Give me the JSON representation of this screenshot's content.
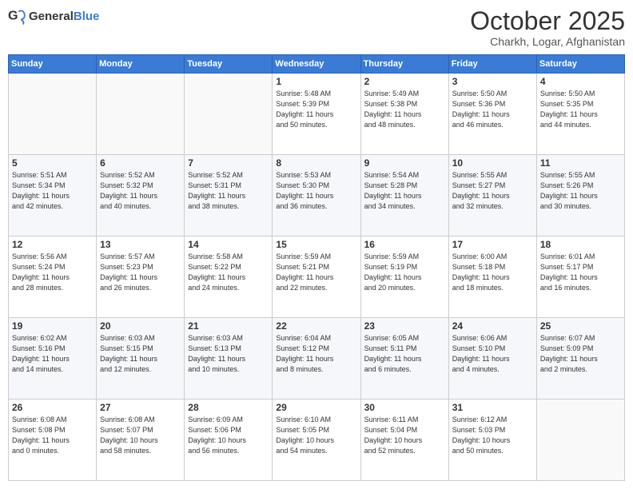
{
  "header": {
    "logo_general": "General",
    "logo_blue": "Blue",
    "month": "October 2025",
    "location": "Charkh, Logar, Afghanistan"
  },
  "weekdays": [
    "Sunday",
    "Monday",
    "Tuesday",
    "Wednesday",
    "Thursday",
    "Friday",
    "Saturday"
  ],
  "weeks": [
    [
      {
        "day": "",
        "info": ""
      },
      {
        "day": "",
        "info": ""
      },
      {
        "day": "",
        "info": ""
      },
      {
        "day": "1",
        "info": "Sunrise: 5:48 AM\nSunset: 5:39 PM\nDaylight: 11 hours\nand 50 minutes."
      },
      {
        "day": "2",
        "info": "Sunrise: 5:49 AM\nSunset: 5:38 PM\nDaylight: 11 hours\nand 48 minutes."
      },
      {
        "day": "3",
        "info": "Sunrise: 5:50 AM\nSunset: 5:36 PM\nDaylight: 11 hours\nand 46 minutes."
      },
      {
        "day": "4",
        "info": "Sunrise: 5:50 AM\nSunset: 5:35 PM\nDaylight: 11 hours\nand 44 minutes."
      }
    ],
    [
      {
        "day": "5",
        "info": "Sunrise: 5:51 AM\nSunset: 5:34 PM\nDaylight: 11 hours\nand 42 minutes."
      },
      {
        "day": "6",
        "info": "Sunrise: 5:52 AM\nSunset: 5:32 PM\nDaylight: 11 hours\nand 40 minutes."
      },
      {
        "day": "7",
        "info": "Sunrise: 5:52 AM\nSunset: 5:31 PM\nDaylight: 11 hours\nand 38 minutes."
      },
      {
        "day": "8",
        "info": "Sunrise: 5:53 AM\nSunset: 5:30 PM\nDaylight: 11 hours\nand 36 minutes."
      },
      {
        "day": "9",
        "info": "Sunrise: 5:54 AM\nSunset: 5:28 PM\nDaylight: 11 hours\nand 34 minutes."
      },
      {
        "day": "10",
        "info": "Sunrise: 5:55 AM\nSunset: 5:27 PM\nDaylight: 11 hours\nand 32 minutes."
      },
      {
        "day": "11",
        "info": "Sunrise: 5:55 AM\nSunset: 5:26 PM\nDaylight: 11 hours\nand 30 minutes."
      }
    ],
    [
      {
        "day": "12",
        "info": "Sunrise: 5:56 AM\nSunset: 5:24 PM\nDaylight: 11 hours\nand 28 minutes."
      },
      {
        "day": "13",
        "info": "Sunrise: 5:57 AM\nSunset: 5:23 PM\nDaylight: 11 hours\nand 26 minutes."
      },
      {
        "day": "14",
        "info": "Sunrise: 5:58 AM\nSunset: 5:22 PM\nDaylight: 11 hours\nand 24 minutes."
      },
      {
        "day": "15",
        "info": "Sunrise: 5:59 AM\nSunset: 5:21 PM\nDaylight: 11 hours\nand 22 minutes."
      },
      {
        "day": "16",
        "info": "Sunrise: 5:59 AM\nSunset: 5:19 PM\nDaylight: 11 hours\nand 20 minutes."
      },
      {
        "day": "17",
        "info": "Sunrise: 6:00 AM\nSunset: 5:18 PM\nDaylight: 11 hours\nand 18 minutes."
      },
      {
        "day": "18",
        "info": "Sunrise: 6:01 AM\nSunset: 5:17 PM\nDaylight: 11 hours\nand 16 minutes."
      }
    ],
    [
      {
        "day": "19",
        "info": "Sunrise: 6:02 AM\nSunset: 5:16 PM\nDaylight: 11 hours\nand 14 minutes."
      },
      {
        "day": "20",
        "info": "Sunrise: 6:03 AM\nSunset: 5:15 PM\nDaylight: 11 hours\nand 12 minutes."
      },
      {
        "day": "21",
        "info": "Sunrise: 6:03 AM\nSunset: 5:13 PM\nDaylight: 11 hours\nand 10 minutes."
      },
      {
        "day": "22",
        "info": "Sunrise: 6:04 AM\nSunset: 5:12 PM\nDaylight: 11 hours\nand 8 minutes."
      },
      {
        "day": "23",
        "info": "Sunrise: 6:05 AM\nSunset: 5:11 PM\nDaylight: 11 hours\nand 6 minutes."
      },
      {
        "day": "24",
        "info": "Sunrise: 6:06 AM\nSunset: 5:10 PM\nDaylight: 11 hours\nand 4 minutes."
      },
      {
        "day": "25",
        "info": "Sunrise: 6:07 AM\nSunset: 5:09 PM\nDaylight: 11 hours\nand 2 minutes."
      }
    ],
    [
      {
        "day": "26",
        "info": "Sunrise: 6:08 AM\nSunset: 5:08 PM\nDaylight: 11 hours\nand 0 minutes."
      },
      {
        "day": "27",
        "info": "Sunrise: 6:08 AM\nSunset: 5:07 PM\nDaylight: 10 hours\nand 58 minutes."
      },
      {
        "day": "28",
        "info": "Sunrise: 6:09 AM\nSunset: 5:06 PM\nDaylight: 10 hours\nand 56 minutes."
      },
      {
        "day": "29",
        "info": "Sunrise: 6:10 AM\nSunset: 5:05 PM\nDaylight: 10 hours\nand 54 minutes."
      },
      {
        "day": "30",
        "info": "Sunrise: 6:11 AM\nSunset: 5:04 PM\nDaylight: 10 hours\nand 52 minutes."
      },
      {
        "day": "31",
        "info": "Sunrise: 6:12 AM\nSunset: 5:03 PM\nDaylight: 10 hours\nand 50 minutes."
      },
      {
        "day": "",
        "info": ""
      }
    ]
  ]
}
